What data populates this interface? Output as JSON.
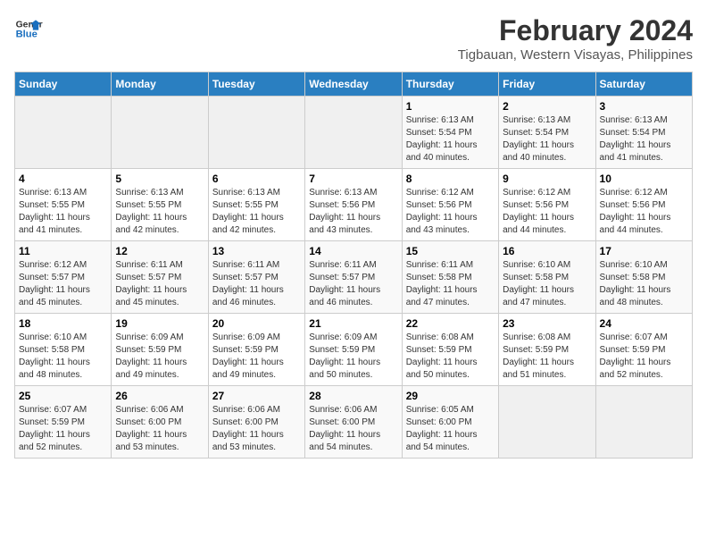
{
  "header": {
    "logo_line1": "General",
    "logo_line2": "Blue",
    "main_title": "February 2024",
    "subtitle": "Tigbauan, Western Visayas, Philippines"
  },
  "days_of_week": [
    "Sunday",
    "Monday",
    "Tuesday",
    "Wednesday",
    "Thursday",
    "Friday",
    "Saturday"
  ],
  "weeks": [
    [
      {
        "day": "",
        "info": ""
      },
      {
        "day": "",
        "info": ""
      },
      {
        "day": "",
        "info": ""
      },
      {
        "day": "",
        "info": ""
      },
      {
        "day": "1",
        "info": "Sunrise: 6:13 AM\nSunset: 5:54 PM\nDaylight: 11 hours\nand 40 minutes."
      },
      {
        "day": "2",
        "info": "Sunrise: 6:13 AM\nSunset: 5:54 PM\nDaylight: 11 hours\nand 40 minutes."
      },
      {
        "day": "3",
        "info": "Sunrise: 6:13 AM\nSunset: 5:54 PM\nDaylight: 11 hours\nand 41 minutes."
      }
    ],
    [
      {
        "day": "4",
        "info": "Sunrise: 6:13 AM\nSunset: 5:55 PM\nDaylight: 11 hours\nand 41 minutes."
      },
      {
        "day": "5",
        "info": "Sunrise: 6:13 AM\nSunset: 5:55 PM\nDaylight: 11 hours\nand 42 minutes."
      },
      {
        "day": "6",
        "info": "Sunrise: 6:13 AM\nSunset: 5:55 PM\nDaylight: 11 hours\nand 42 minutes."
      },
      {
        "day": "7",
        "info": "Sunrise: 6:13 AM\nSunset: 5:56 PM\nDaylight: 11 hours\nand 43 minutes."
      },
      {
        "day": "8",
        "info": "Sunrise: 6:12 AM\nSunset: 5:56 PM\nDaylight: 11 hours\nand 43 minutes."
      },
      {
        "day": "9",
        "info": "Sunrise: 6:12 AM\nSunset: 5:56 PM\nDaylight: 11 hours\nand 44 minutes."
      },
      {
        "day": "10",
        "info": "Sunrise: 6:12 AM\nSunset: 5:56 PM\nDaylight: 11 hours\nand 44 minutes."
      }
    ],
    [
      {
        "day": "11",
        "info": "Sunrise: 6:12 AM\nSunset: 5:57 PM\nDaylight: 11 hours\nand 45 minutes."
      },
      {
        "day": "12",
        "info": "Sunrise: 6:11 AM\nSunset: 5:57 PM\nDaylight: 11 hours\nand 45 minutes."
      },
      {
        "day": "13",
        "info": "Sunrise: 6:11 AM\nSunset: 5:57 PM\nDaylight: 11 hours\nand 46 minutes."
      },
      {
        "day": "14",
        "info": "Sunrise: 6:11 AM\nSunset: 5:57 PM\nDaylight: 11 hours\nand 46 minutes."
      },
      {
        "day": "15",
        "info": "Sunrise: 6:11 AM\nSunset: 5:58 PM\nDaylight: 11 hours\nand 47 minutes."
      },
      {
        "day": "16",
        "info": "Sunrise: 6:10 AM\nSunset: 5:58 PM\nDaylight: 11 hours\nand 47 minutes."
      },
      {
        "day": "17",
        "info": "Sunrise: 6:10 AM\nSunset: 5:58 PM\nDaylight: 11 hours\nand 48 minutes."
      }
    ],
    [
      {
        "day": "18",
        "info": "Sunrise: 6:10 AM\nSunset: 5:58 PM\nDaylight: 11 hours\nand 48 minutes."
      },
      {
        "day": "19",
        "info": "Sunrise: 6:09 AM\nSunset: 5:59 PM\nDaylight: 11 hours\nand 49 minutes."
      },
      {
        "day": "20",
        "info": "Sunrise: 6:09 AM\nSunset: 5:59 PM\nDaylight: 11 hours\nand 49 minutes."
      },
      {
        "day": "21",
        "info": "Sunrise: 6:09 AM\nSunset: 5:59 PM\nDaylight: 11 hours\nand 50 minutes."
      },
      {
        "day": "22",
        "info": "Sunrise: 6:08 AM\nSunset: 5:59 PM\nDaylight: 11 hours\nand 50 minutes."
      },
      {
        "day": "23",
        "info": "Sunrise: 6:08 AM\nSunset: 5:59 PM\nDaylight: 11 hours\nand 51 minutes."
      },
      {
        "day": "24",
        "info": "Sunrise: 6:07 AM\nSunset: 5:59 PM\nDaylight: 11 hours\nand 52 minutes."
      }
    ],
    [
      {
        "day": "25",
        "info": "Sunrise: 6:07 AM\nSunset: 5:59 PM\nDaylight: 11 hours\nand 52 minutes."
      },
      {
        "day": "26",
        "info": "Sunrise: 6:06 AM\nSunset: 6:00 PM\nDaylight: 11 hours\nand 53 minutes."
      },
      {
        "day": "27",
        "info": "Sunrise: 6:06 AM\nSunset: 6:00 PM\nDaylight: 11 hours\nand 53 minutes."
      },
      {
        "day": "28",
        "info": "Sunrise: 6:06 AM\nSunset: 6:00 PM\nDaylight: 11 hours\nand 54 minutes."
      },
      {
        "day": "29",
        "info": "Sunrise: 6:05 AM\nSunset: 6:00 PM\nDaylight: 11 hours\nand 54 minutes."
      },
      {
        "day": "",
        "info": ""
      },
      {
        "day": "",
        "info": ""
      }
    ]
  ]
}
